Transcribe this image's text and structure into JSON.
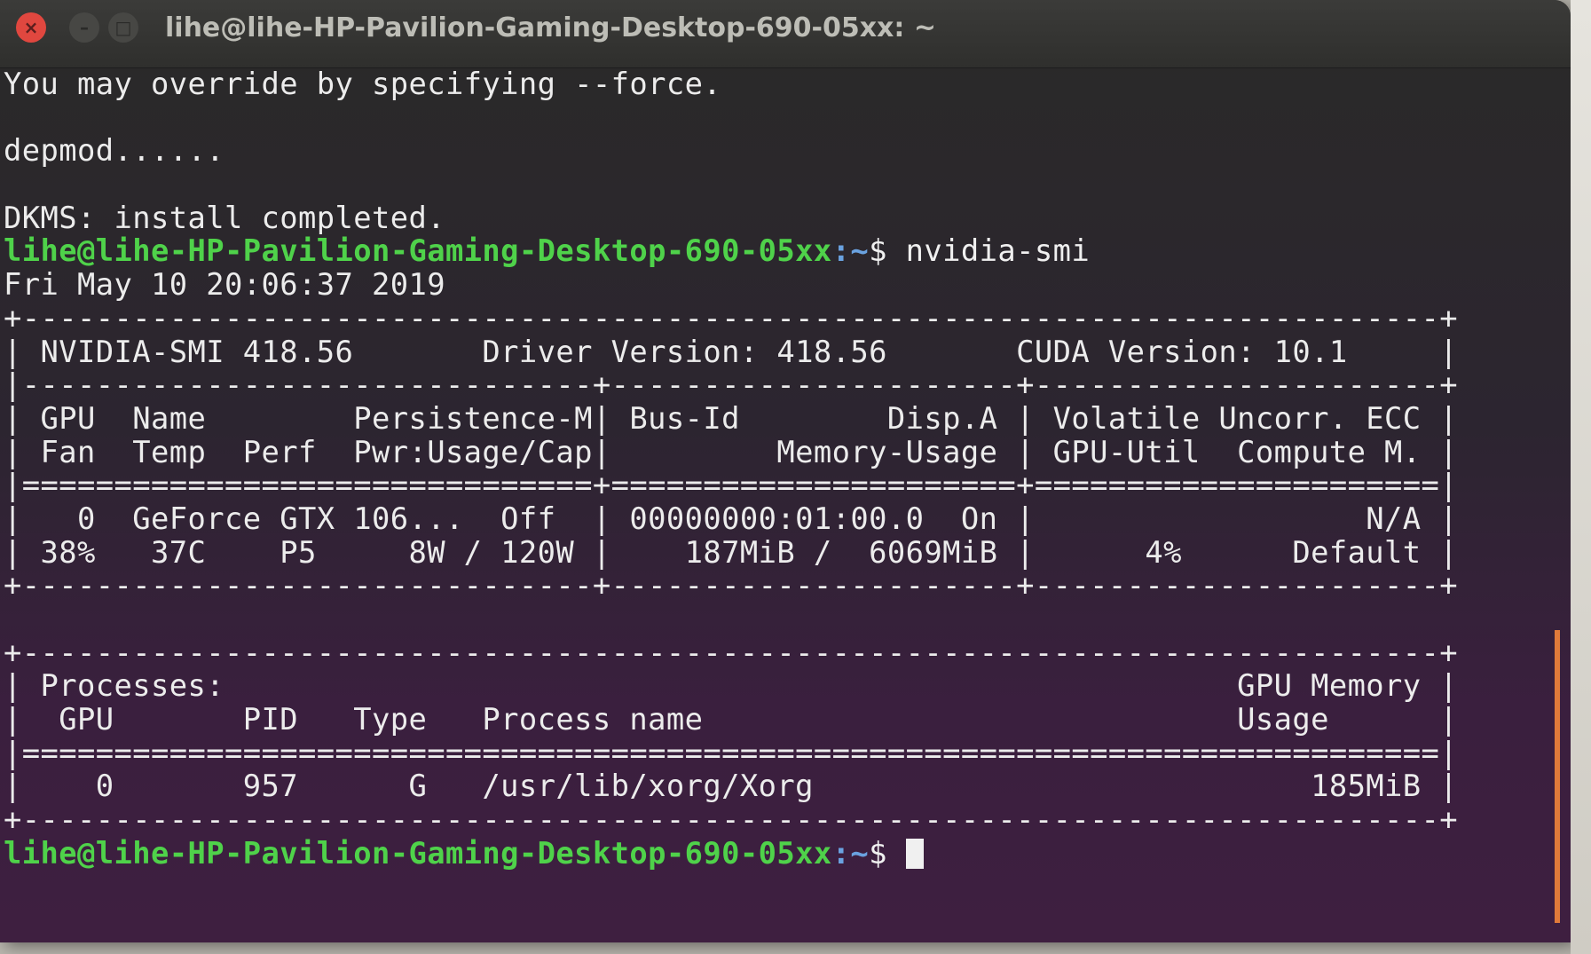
{
  "window": {
    "title": "lihe@lihe-HP-Pavilion-Gaming-Desktop-690-05xx: ~",
    "close_icon": "close-icon",
    "minimize_icon": "minimize-icon",
    "maximize_icon": "maximize-icon"
  },
  "terminal": {
    "pre_output": [
      "You may override by specifying --force.",
      "",
      "depmod......",
      "",
      "DKMS: install completed."
    ],
    "prompt_user": "lihe@lihe-HP-Pavilion-Gaming-Desktop-690-05xx",
    "prompt_sep": ":",
    "prompt_path": "~",
    "prompt_symbol": "$ ",
    "command": "nvidia-smi",
    "output": [
      "Fri May 10 20:06:37 2019",
      "+-----------------------------------------------------------------------------+",
      "| NVIDIA-SMI 418.56       Driver Version: 418.56       CUDA Version: 10.1     |",
      "|-------------------------------+----------------------+----------------------+",
      "| GPU  Name        Persistence-M| Bus-Id        Disp.A | Volatile Uncorr. ECC |",
      "| Fan  Temp  Perf  Pwr:Usage/Cap|         Memory-Usage | GPU-Util  Compute M. |",
      "|===============================+======================+======================|",
      "|   0  GeForce GTX 106...  Off  | 00000000:01:00.0  On |                  N/A |",
      "| 38%   37C    P5     8W / 120W |    187MiB /  6069MiB |      4%      Default |",
      "+-------------------------------+----------------------+----------------------+",
      "",
      "+-----------------------------------------------------------------------------+",
      "| Processes:                                                       GPU Memory |",
      "|  GPU       PID   Type   Process name                             Usage      |",
      "|=============================================================================|",
      "|    0       957      G   /usr/lib/xorg/Xorg                           185MiB |",
      "+-----------------------------------------------------------------------------+"
    ],
    "final_prompt_symbol": "$ "
  }
}
